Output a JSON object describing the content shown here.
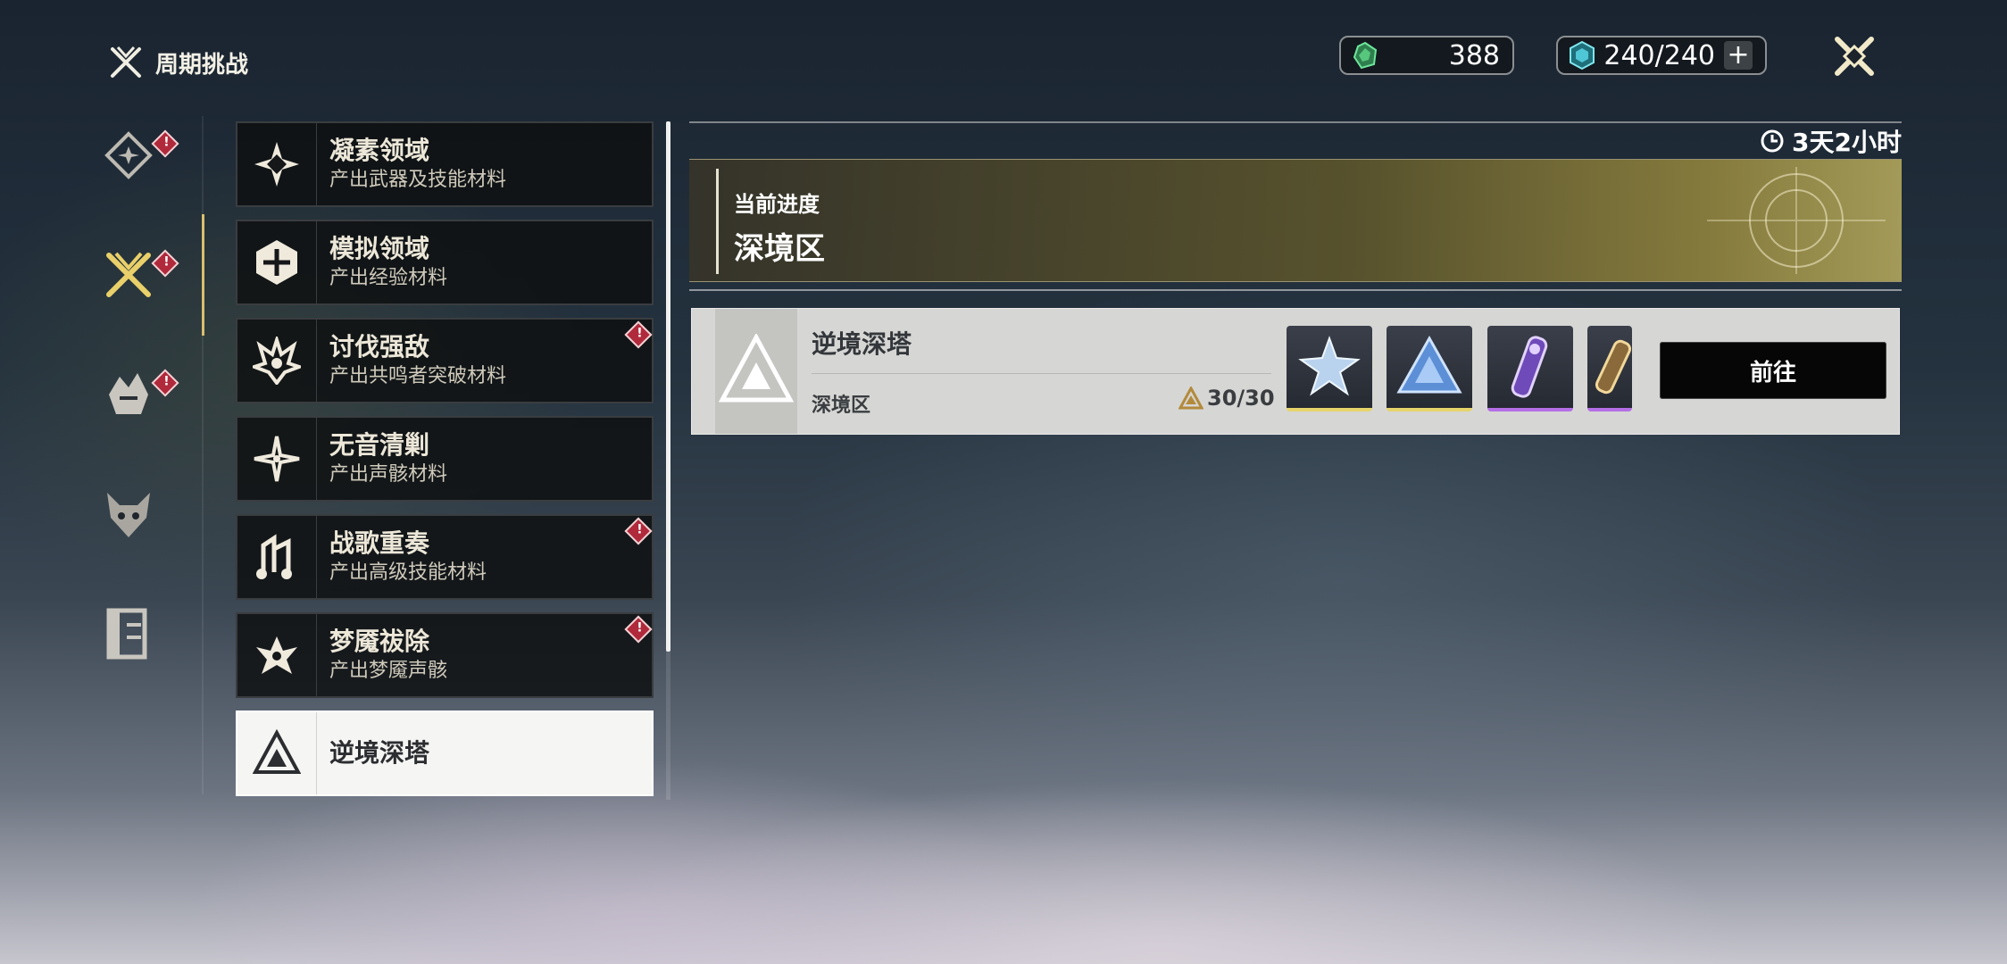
{
  "header": {
    "title": "周期挑战"
  },
  "currencies": [
    {
      "icon": "green-crystal-icon",
      "value": "388"
    },
    {
      "icon": "waveplate-crystal-icon",
      "value": "240/240"
    }
  ],
  "rail": [
    {
      "icon": "diamond-star-icon",
      "badge": true
    },
    {
      "icon": "crossed-swords-icon",
      "badge": true,
      "active": true
    },
    {
      "icon": "crown-mask-icon",
      "badge": true
    },
    {
      "icon": "demon-head-icon",
      "badge": false
    },
    {
      "icon": "logbook-icon",
      "badge": false
    }
  ],
  "challenges": [
    {
      "name": "凝素领域",
      "sub": "产出武器及技能材料",
      "badge": false
    },
    {
      "name": "模拟领域",
      "sub": "产出经验材料",
      "badge": false
    },
    {
      "name": "讨伐强敌",
      "sub": "产出共鸣者突破材料",
      "badge": true
    },
    {
      "name": "无音清剿",
      "sub": "产出声骸材料",
      "badge": false
    },
    {
      "name": "战歌重奏",
      "sub": "产出高级技能材料",
      "badge": true
    },
    {
      "name": "梦魇祓除",
      "sub": "产出梦魇声骸",
      "badge": true
    },
    {
      "name": "逆境深塔",
      "sub": "",
      "badge": false,
      "active": true
    }
  ],
  "timer": "3天2小时",
  "progress": {
    "label": "当前进度",
    "value": "深境区"
  },
  "entry": {
    "title": "逆境深塔",
    "sub": "深境区",
    "count": "30/30",
    "go_label": "前往",
    "rewards": [
      {
        "icon": "star-crystal-icon",
        "rarity": "gold"
      },
      {
        "icon": "triangle-crystal-icon",
        "rarity": "gold"
      },
      {
        "icon": "purple-tube-icon",
        "rarity": "purple"
      },
      {
        "icon": "partial-reward-icon",
        "rarity": "purple"
      }
    ]
  }
}
